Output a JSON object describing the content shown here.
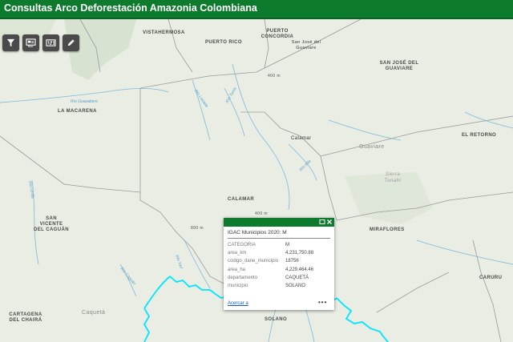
{
  "app": {
    "title": "Consultas Arco Deforestación Amazonia Colombiana"
  },
  "toolbar": [
    {
      "name": "filter-button",
      "icon": "filter-icon"
    },
    {
      "name": "layers-button",
      "icon": "layers-icon"
    },
    {
      "name": "measure-button",
      "icon": "measure-icon"
    },
    {
      "name": "draw-button",
      "icon": "pencil-icon"
    }
  ],
  "map": {
    "places": [
      "VISTAHERMOSA",
      "PUERTO RICO",
      "PUERTO CONCORDIA",
      "San José del Guaviare",
      "SAN JOSÉ DEL GUAVIARE",
      "LA MACARENA",
      "Calamar",
      "EL RETORNO",
      "Guaviare",
      "Sierra Tunahí",
      "CALAMAR",
      "SAN VICENTE DEL CAGUÁN",
      "MIRAFLORES",
      "CARURU",
      "Caquetá",
      "CARTAGENA DEL CHAIRÁ",
      "SOLANO"
    ],
    "rivers": [
      "Río Guayabero",
      "Río Losada",
      "Río Tunia",
      "Río Itilla",
      "Río Unilla",
      "Río Vaupés",
      "Río Yarí",
      "Río Caguán"
    ],
    "elevations": [
      "400 m",
      "890 m",
      "400 m"
    ]
  },
  "popup": {
    "title": "IGAC Municipios 2020: M",
    "rows": [
      {
        "key": "CATEGORIA",
        "value": "M"
      },
      {
        "key": "area_km",
        "value": "4,231,750.88"
      },
      {
        "key": "codigo_dane_municipio",
        "value": "18756"
      },
      {
        "key": "area_ha",
        "value": "4,229,464.46"
      },
      {
        "key": "departamento",
        "value": "CAQUETÁ"
      },
      {
        "key": "municipio",
        "value": "SOLANO"
      }
    ],
    "zoom_label": "Acercar a",
    "more_label": "•••",
    "maximize_icon": "maximize-icon",
    "close_icon": "close-icon"
  },
  "colors": {
    "header": "#0e7a2e",
    "boundary": "#00e5ff",
    "land": "#e9ede4"
  }
}
